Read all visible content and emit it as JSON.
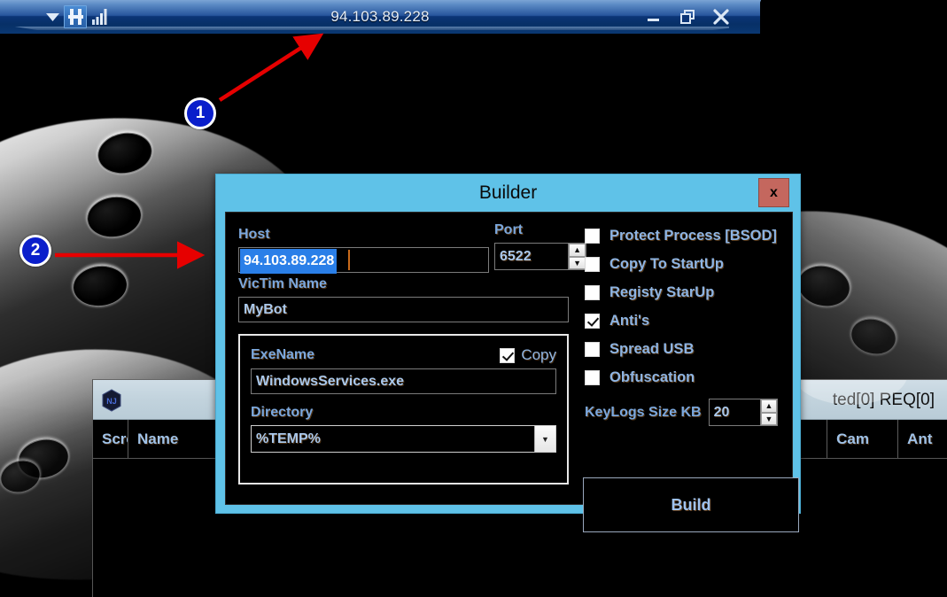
{
  "window": {
    "title": "94.103.89.228",
    "icons": {
      "dropdown": "chevron-down-icon",
      "app": "hospital-h-icon",
      "signal": "signal-bars-icon"
    },
    "controls": {
      "minimize": "minimize-icon",
      "restore": "restore-icon",
      "close": "close-icon"
    }
  },
  "background_app": {
    "logo": "nj-hexagon-logo",
    "status": "ted[0] REQ[0]",
    "columns": [
      "Scre",
      "Name",
      "Cam",
      "Ant"
    ]
  },
  "builder": {
    "title": "Builder",
    "close_label": "x",
    "host": {
      "label": "Host",
      "value": "94.103.89.228",
      "selected": true
    },
    "port": {
      "label": "Port",
      "value": "6522",
      "spinner_up": "▲",
      "spinner_down": "▼"
    },
    "victim": {
      "label": "VicTim Name",
      "value": "MyBot"
    },
    "exe_group": {
      "exename_label": "ExeName",
      "exename_value": "WindowsServices.exe",
      "copy_label": "Copy",
      "copy_checked": true,
      "directory_label": "Directory",
      "directory_value": "%TEMP%",
      "directory_arrow": "chevron-down-icon"
    },
    "options": [
      {
        "label": "Protect Process [BSOD]",
        "checked": false
      },
      {
        "label": "Copy To StartUp",
        "checked": false
      },
      {
        "label": "Registy StarUp",
        "checked": false
      },
      {
        "label": "Anti's",
        "checked": true
      },
      {
        "label": "Spread USB",
        "checked": false
      },
      {
        "label": "Obfuscation",
        "checked": false
      }
    ],
    "keylogs": {
      "label": "KeyLogs Size KB",
      "value": "20"
    },
    "build_label": "Build"
  },
  "annotations": [
    {
      "id": "1",
      "label": "1"
    },
    {
      "id": "2",
      "label": "2"
    }
  ],
  "colors": {
    "dialog_accent": "#5fc2e8",
    "close_button": "#c4675e",
    "titlebar_blue": "#0b3476",
    "field_text": "#a9c8ec",
    "label_blue": "#7aa7dd",
    "selection": "#2a7fe8",
    "annotation": "#0a1ecb"
  }
}
